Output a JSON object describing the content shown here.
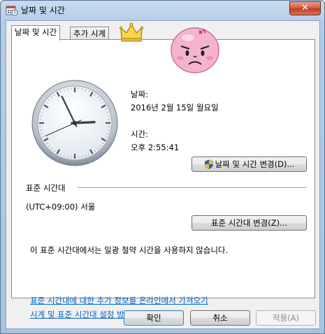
{
  "window": {
    "title": "날짜 및 시간",
    "close_label": "✕"
  },
  "tabs": [
    {
      "label": "날짜 및 시간",
      "selected": true
    },
    {
      "label": "추가 시계",
      "selected": false
    }
  ],
  "date": {
    "label": "날짜:",
    "value": "2016년 2월 15일 월요일"
  },
  "time": {
    "label": "시간:",
    "value": "오후 2:55:41"
  },
  "clock": {
    "hour": 2,
    "minute": 55,
    "second": 41
  },
  "change_datetime_button": "날짜 및 시간 변경(D)...",
  "timezone": {
    "section_label": "표준 시간대",
    "value": "(UTC+09:00) 서울",
    "change_button": "표준 시간대 변경(Z)...",
    "dst_note": "이 표준 시간대에서는 일광 절약 시간을 사용하지 않습니다."
  },
  "links": {
    "online_info": "표준 시간대에 대한 추가 정보를 온라인에서 가져오기",
    "help": "시계 및 표준 시간대 설정 방법"
  },
  "footer": {
    "ok": "확인",
    "cancel": "취소",
    "apply": "적용(A)"
  },
  "colors": {
    "link": "#0066cc",
    "title_bar": "#b5cde6",
    "close": "#c0391e"
  }
}
